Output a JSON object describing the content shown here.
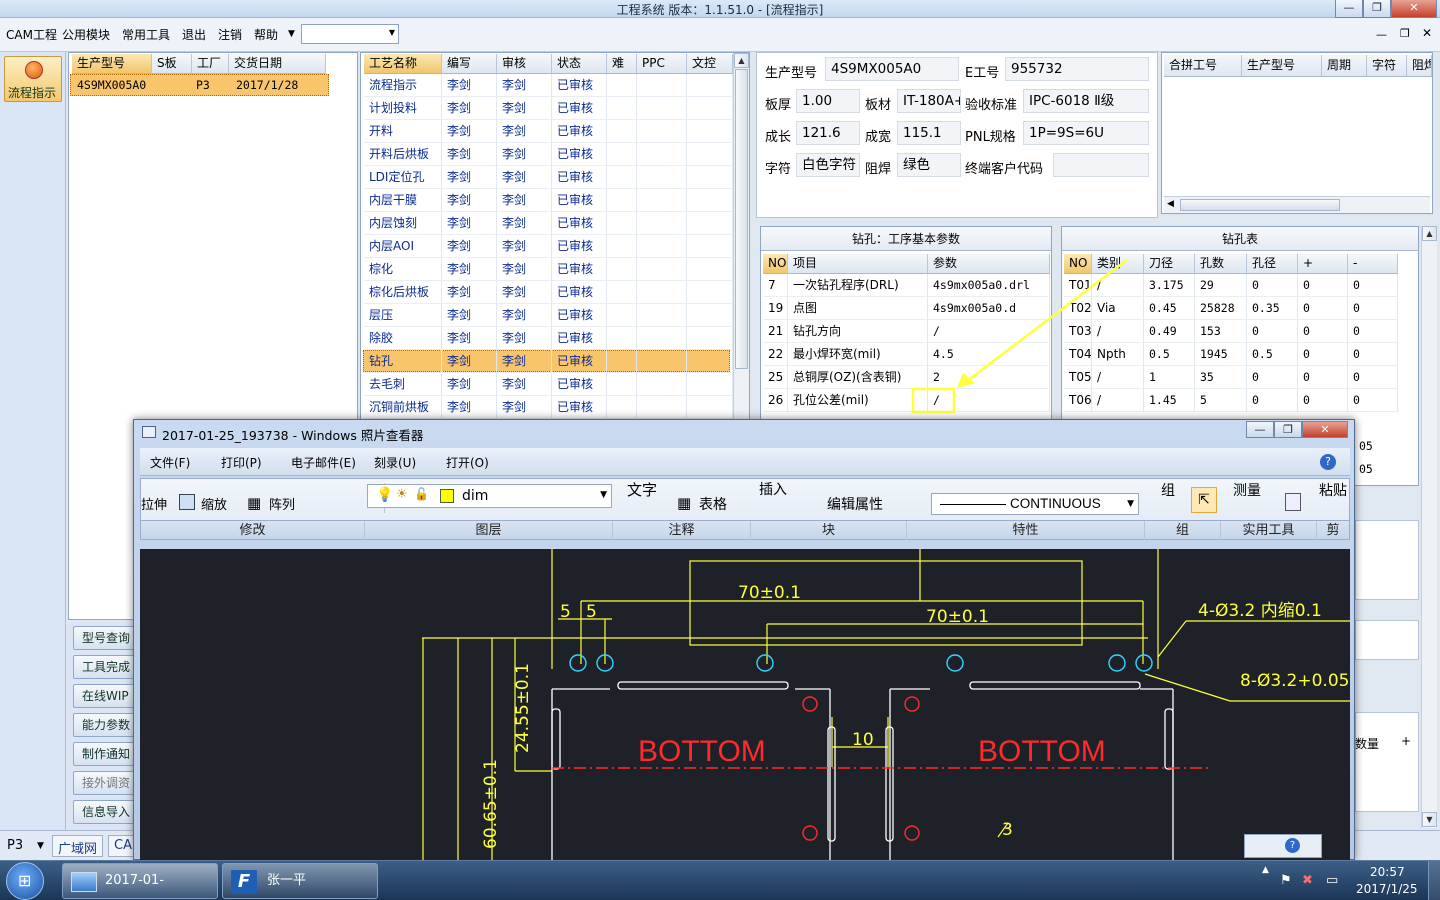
{
  "window": {
    "title": "工程系统    版本：1.1.51.0 - [流程指示]"
  },
  "menu": [
    "CAM工程",
    "公用模块",
    "常用工具",
    "退出",
    "注销",
    "帮助"
  ],
  "left_nav": {
    "active": "流程指示",
    "buttons": [
      "型号查询",
      "工具完成",
      "在线WIP",
      "能力参数",
      "制作通知",
      "接外调资",
      "信息导入"
    ]
  },
  "order_table": {
    "columns": [
      "生产型号",
      "S板",
      "工厂",
      "交货日期"
    ],
    "rows": [
      [
        "4S9MX005A0",
        "",
        "P3",
        "2017/1/28"
      ]
    ]
  },
  "process_table": {
    "columns": [
      "工艺名称",
      "编写",
      "审核",
      "状态",
      "难",
      "PPC",
      "文控"
    ],
    "rows": [
      [
        "流程指示",
        "李剑",
        "李剑",
        "已审核"
      ],
      [
        "计划投料",
        "李剑",
        "李剑",
        "已审核"
      ],
      [
        "开料",
        "李剑",
        "李剑",
        "已审核"
      ],
      [
        "开料后烘板",
        "李剑",
        "李剑",
        "已审核"
      ],
      [
        "LDI定位孔",
        "李剑",
        "李剑",
        "已审核"
      ],
      [
        "内层干膜",
        "李剑",
        "李剑",
        "已审核"
      ],
      [
        "内层蚀刻",
        "李剑",
        "李剑",
        "已审核"
      ],
      [
        "内层AOI",
        "李剑",
        "李剑",
        "已审核"
      ],
      [
        "棕化",
        "李剑",
        "李剑",
        "已审核"
      ],
      [
        "棕化后烘板",
        "李剑",
        "李剑",
        "已审核"
      ],
      [
        "层压",
        "李剑",
        "李剑",
        "已审核"
      ],
      [
        "除胶",
        "李剑",
        "李剑",
        "已审核"
      ],
      [
        "钻孔",
        "李剑",
        "李剑",
        "已审核"
      ],
      [
        "去毛刺",
        "李剑",
        "李剑",
        "已审核"
      ],
      [
        "沉铜前烘板",
        "李剑",
        "李剑",
        "已审核"
      ]
    ],
    "selected_index": 12
  },
  "info": {
    "labels": {
      "model": "生产型号",
      "ework": "E工号",
      "thick": "板厚",
      "mat": "板材",
      "accept": "验收标准",
      "len": "成长",
      "wid": "成宽",
      "pnl": "PNL规格",
      "char": "字符",
      "mask": "阻焊",
      "cust": "终端客户代码"
    },
    "values": {
      "model": "4S9MX005A0",
      "ework": "955732",
      "thick": "1.00",
      "mat": "IT-180A+",
      "accept": "IPC-6018 Ⅱ级",
      "len": "121.6",
      "wid": "115.1",
      "pnl": "1P=9S=6U",
      "char": "白色字符",
      "mask": "绿色",
      "cust": ""
    }
  },
  "merge_table": {
    "columns": [
      "合拼工号",
      "生产型号",
      "周期",
      "字符",
      "阻焊"
    ]
  },
  "drill_params": {
    "title": "钻孔：工序基本参数",
    "columns": [
      "NO",
      "项目",
      "参数"
    ],
    "rows": [
      [
        "7",
        "一次钻孔程序(DRL)",
        "4s9mx005a0.drl"
      ],
      [
        "19",
        "点图",
        "4s9mx005a0.d"
      ],
      [
        "21",
        "钻孔方向",
        "/"
      ],
      [
        "22",
        "最小焊环宽(mil)",
        "4.5"
      ],
      [
        "25",
        "总铜厚(OZ)(含表铜)",
        "2"
      ],
      [
        "26",
        "孔位公差(mil)",
        "/"
      ]
    ]
  },
  "hole_table": {
    "title": "钻孔表",
    "columns": [
      "NO",
      "类别",
      "刀径",
      "孔数",
      "孔径",
      "+",
      "-"
    ],
    "rows": [
      [
        "T01",
        "/",
        "3.175",
        "29",
        "0",
        "0",
        "0"
      ],
      [
        "T02",
        "Via",
        "0.45",
        "25828",
        "0.35",
        "0",
        "0"
      ],
      [
        "T03",
        "/",
        "0.49",
        "153",
        "0",
        "0",
        "0"
      ],
      [
        "T04",
        "Npth",
        "0.5",
        "1945",
        "0.5",
        "0",
        "0"
      ],
      [
        "T05",
        "/",
        "1",
        "35",
        "0",
        "0",
        "0"
      ],
      [
        "T06",
        "/",
        "1.45",
        "5",
        "0",
        "0",
        "0"
      ]
    ],
    "partial": [
      "05",
      "05"
    ],
    "extra": "数量"
  },
  "viewer": {
    "title": "2017-01-25_193738 - Windows 照片查看器",
    "menu": [
      "文件(F)",
      "打印(P)",
      "电子邮件(E)",
      "刻录(U)",
      "打开(O)"
    ],
    "ribbon": {
      "modify": [
        "拉伸",
        "缩放",
        "阵列"
      ],
      "layer_name": "dim",
      "annot": [
        "文字",
        "表格"
      ],
      "insert": "插入",
      "edit_attr": "编辑属性",
      "linetype": "CONTINUOUS",
      "group": "组",
      "measure": "测量",
      "paste": "粘贴",
      "groups": [
        "修改",
        "图层",
        "注释",
        "块",
        "特性",
        "组",
        "实用工具",
        "剪"
      ]
    }
  },
  "drawing": {
    "dims": [
      "70±0.1",
      "70±0.1",
      "5",
      "5",
      "24.55±0.1",
      "60.65±0.1",
      "10",
      "3"
    ],
    "labels": [
      "BOTTOM",
      "BOTTOM"
    ],
    "notes": [
      "4-Ø3.2 内缩0.1",
      "8-Ø3.2+0.05-0.05"
    ]
  },
  "status": {
    "factory": "P3",
    "tabs": [
      "广域网",
      "CA"
    ]
  },
  "taskbar": {
    "tasks": [
      "2017-01-25_193...",
      "张一平"
    ],
    "time": "20:57",
    "date": "2017/1/25"
  },
  "colors": {
    "selection": "#f8c46c",
    "yellow": "#ffff3c",
    "red": "#ff2b2b",
    "cyan": "#33d6ff"
  }
}
